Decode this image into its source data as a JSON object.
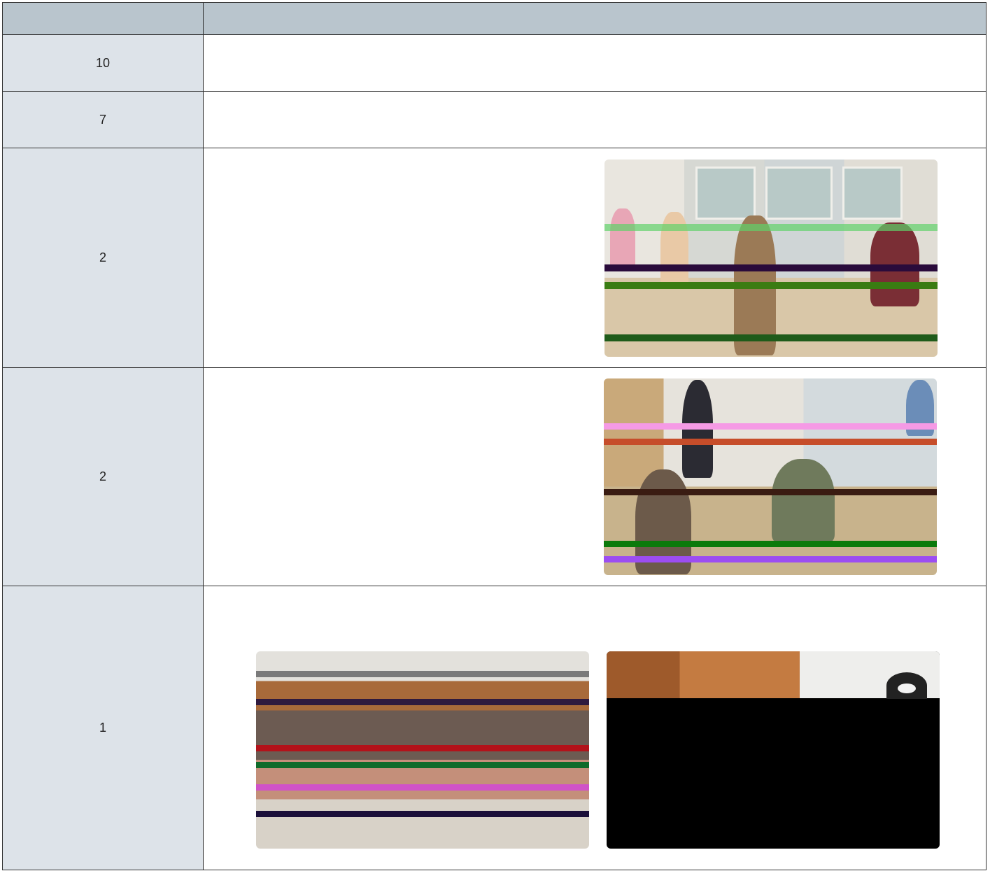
{
  "table": {
    "header": {
      "col1": "",
      "col2": ""
    },
    "rows": [
      {
        "count": "10"
      },
      {
        "count": "7"
      },
      {
        "count": "2"
      },
      {
        "count": "2"
      },
      {
        "count": "1"
      }
    ]
  },
  "photos": {
    "row3": "photo-kitchen",
    "row4": "photo-hall",
    "row5": [
      "photo-crowd",
      "photo-stage"
    ]
  }
}
